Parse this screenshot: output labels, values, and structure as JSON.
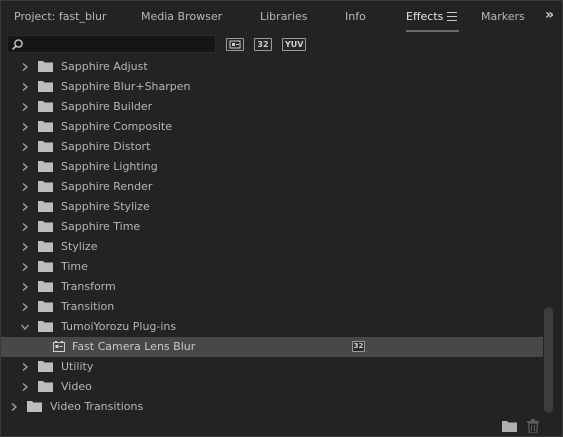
{
  "tabs": [
    {
      "label": "Project: fast_blur",
      "active": false
    },
    {
      "label": "Media Browser",
      "active": false
    },
    {
      "label": "Libraries",
      "active": false
    },
    {
      "label": "Info",
      "active": false
    },
    {
      "label": "Effects",
      "active": true
    },
    {
      "label": "Markers",
      "active": false
    }
  ],
  "overflow_glyph": "»",
  "search": {
    "value": "",
    "placeholder": ""
  },
  "filters": {
    "accelerated": "accelerated-effects-icon",
    "bit32": "32",
    "yuv": "YUV"
  },
  "tree": [
    {
      "label": "Sapphire Adjust",
      "type": "folder",
      "level": 1,
      "expanded": false
    },
    {
      "label": "Sapphire Blur+Sharpen",
      "type": "folder",
      "level": 1,
      "expanded": false
    },
    {
      "label": "Sapphire Builder",
      "type": "folder",
      "level": 1,
      "expanded": false
    },
    {
      "label": "Sapphire Composite",
      "type": "folder",
      "level": 1,
      "expanded": false
    },
    {
      "label": "Sapphire Distort",
      "type": "folder",
      "level": 1,
      "expanded": false
    },
    {
      "label": "Sapphire Lighting",
      "type": "folder",
      "level": 1,
      "expanded": false
    },
    {
      "label": "Sapphire Render",
      "type": "folder",
      "level": 1,
      "expanded": false
    },
    {
      "label": "Sapphire Stylize",
      "type": "folder",
      "level": 1,
      "expanded": false
    },
    {
      "label": "Sapphire Time",
      "type": "folder",
      "level": 1,
      "expanded": false
    },
    {
      "label": "Stylize",
      "type": "folder",
      "level": 1,
      "expanded": false
    },
    {
      "label": "Time",
      "type": "folder",
      "level": 1,
      "expanded": false
    },
    {
      "label": "Transform",
      "type": "folder",
      "level": 1,
      "expanded": false
    },
    {
      "label": "Transition",
      "type": "folder",
      "level": 1,
      "expanded": false
    },
    {
      "label": "TumoiYorozu Plug-ins",
      "type": "folder",
      "level": 1,
      "expanded": true
    },
    {
      "label": "Fast Camera Lens Blur",
      "type": "effect",
      "level": 2,
      "selected": true,
      "badge": "32"
    },
    {
      "label": "Utility",
      "type": "folder",
      "level": 1,
      "expanded": false
    },
    {
      "label": "Video",
      "type": "folder",
      "level": 1,
      "expanded": false
    },
    {
      "label": "Video Transitions",
      "type": "folder",
      "level": 0,
      "expanded": false
    }
  ],
  "bottom_icons": [
    "new-bin-icon",
    "delete-icon"
  ],
  "colors": {
    "panel_bg": "#232323",
    "selected_row": "#484848",
    "text": "#b6b6b6"
  }
}
